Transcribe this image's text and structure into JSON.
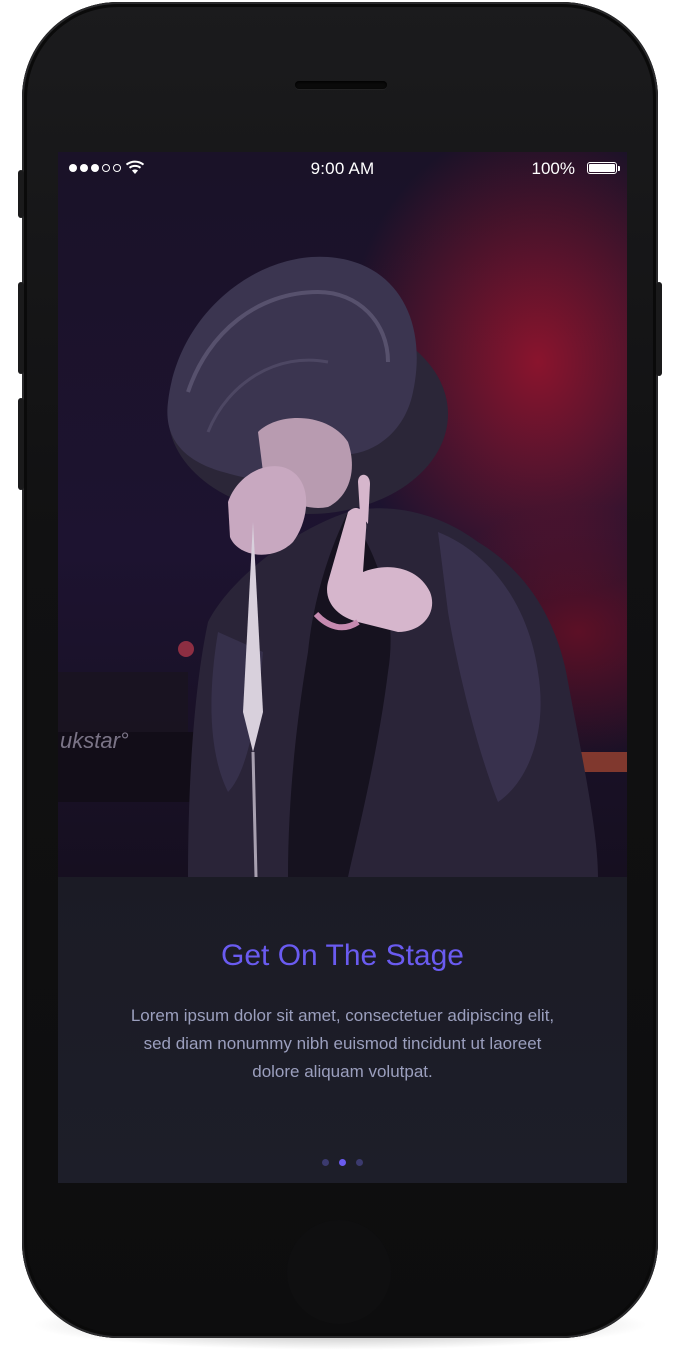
{
  "status_bar": {
    "signal_dots_filled": 3,
    "signal_dots_total": 5,
    "wifi_icon": "wifi-icon",
    "time": "9:00 AM",
    "battery_percent": "100%",
    "battery_level": 1.0
  },
  "hero": {
    "image": "singer-with-microphone-photo"
  },
  "onboarding": {
    "title": "Get On The Stage",
    "body": "Lorem ipsum dolor sit amet, consectetuer adipiscing elit, sed diam nonummy nibh euismod tincidunt ut laoreet dolore aliquam volutpat.",
    "page_count": 3,
    "active_page": 2
  },
  "colors": {
    "accent": "#6a5bf0",
    "body_text": "#9b9fbe",
    "panel_bg": "#1c1d28",
    "inactive_dot": "#3b3a6e"
  }
}
